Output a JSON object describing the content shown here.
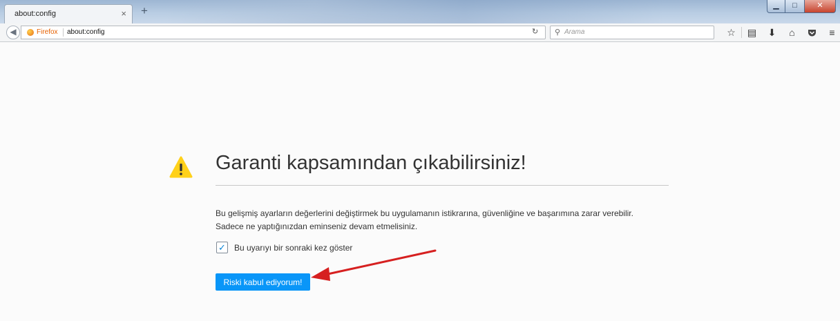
{
  "window": {
    "tab_title": "about:config",
    "tab_close": "×",
    "new_tab": "+",
    "minimize": "▁",
    "maximize": "□",
    "close": "✕"
  },
  "navbar": {
    "identity_label": "Firefox",
    "url": "about:config",
    "search_placeholder": "Arama"
  },
  "toolbar_icons": [
    "star-icon",
    "reading-list-icon",
    "download-icon",
    "home-icon",
    "pocket-icon",
    "menu-icon"
  ],
  "warning": {
    "title": "Garanti kapsamından çıkabilirsiniz!",
    "line1": "Bu gelişmiş ayarların değerlerini değiştirmek bu uygulamanın istikrarına, güvenliğine ve başarımına zarar verebilir.",
    "line2": "Sadece ne yaptığınızdan eminseniz devam etmelisiniz.",
    "checkbox_label": "Bu uyarıyı bir sonraki kez göster",
    "checkbox_checked": true,
    "accept_button": "Riski kabul ediyorum!"
  },
  "colors": {
    "accent": "#0996f8",
    "warning_icon": "#ffd11a",
    "annotation_arrow": "#d62020"
  }
}
